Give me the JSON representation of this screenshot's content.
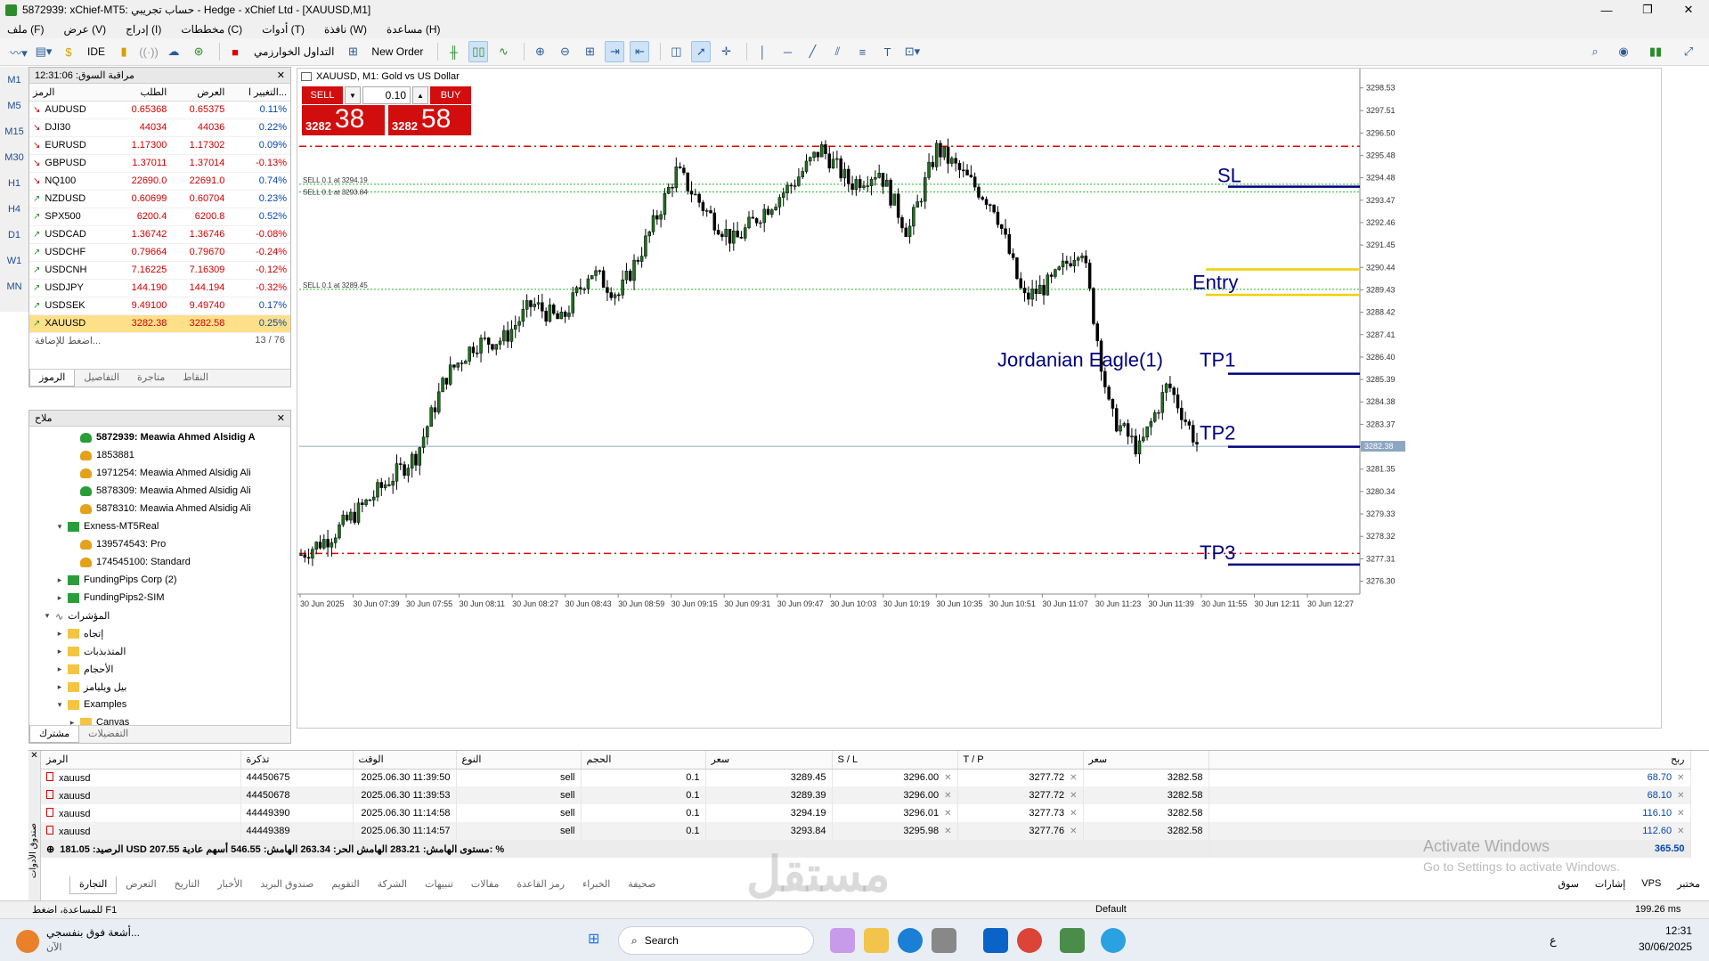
{
  "window": {
    "title": "5872939: xChief-MT5: حساب تجريبي - Hedge - xChief Ltd - [XAUUSD,M1]",
    "minimize": "—",
    "maximize": "❐",
    "close": "✕"
  },
  "menu": [
    "ملف (F)",
    "عرض (V)",
    "إدراج (I)",
    "مخططات (C)",
    "أدوات (T)",
    "نافذة (W)",
    "مساعدة (H)"
  ],
  "toolbar": {
    "ide": "IDE",
    "algo": "التداول الخوارزمي",
    "new_order": "New Order"
  },
  "timeframes": [
    "M1",
    "M5",
    "M15",
    "M30",
    "H1",
    "H4",
    "D1",
    "W1",
    "MN"
  ],
  "selected_timeframe": "M1",
  "market_watch": {
    "title": "مراقبة السوق: 12:31:06",
    "columns": [
      "الرمز",
      "الطلب",
      "العرض",
      "التغيير ا..."
    ],
    "rows": [
      {
        "symbol": "AUDUSD",
        "bid": "0.65368",
        "ask": "0.65375",
        "change": "0.11%",
        "dir": "down"
      },
      {
        "symbol": "DJI30",
        "bid": "44034",
        "ask": "44036",
        "change": "0.22%",
        "dir": "down"
      },
      {
        "symbol": "EURUSD",
        "bid": "1.17300",
        "ask": "1.17302",
        "change": "0.09%",
        "dir": "down"
      },
      {
        "symbol": "GBPUSD",
        "bid": "1.37011",
        "ask": "1.37014",
        "change": "-0.13%",
        "dir": "down"
      },
      {
        "symbol": "NQ100",
        "bid": "22690.0",
        "ask": "22691.0",
        "change": "0.74%",
        "dir": "down"
      },
      {
        "symbol": "NZDUSD",
        "bid": "0.60699",
        "ask": "0.60704",
        "change": "0.23%",
        "dir": "up"
      },
      {
        "symbol": "SPX500",
        "bid": "6200.4",
        "ask": "6200.8",
        "change": "0.52%",
        "dir": "up"
      },
      {
        "symbol": "USDCAD",
        "bid": "1.36742",
        "ask": "1.36746",
        "change": "-0.08%",
        "dir": "up"
      },
      {
        "symbol": "USDCHF",
        "bid": "0.79664",
        "ask": "0.79670",
        "change": "-0.24%",
        "dir": "up"
      },
      {
        "symbol": "USDCNH",
        "bid": "7.16225",
        "ask": "7.16309",
        "change": "-0.12%",
        "dir": "up"
      },
      {
        "symbol": "USDJPY",
        "bid": "144.190",
        "ask": "144.194",
        "change": "-0.32%",
        "dir": "up"
      },
      {
        "symbol": "USDSEK",
        "bid": "9.49100",
        "ask": "9.49740",
        "change": "0.17%",
        "dir": "up"
      },
      {
        "symbol": "XAUUSD",
        "bid": "3282.38",
        "ask": "3282.58",
        "change": "0.25%",
        "dir": "up"
      }
    ],
    "add_hint": "اضغط للإضافة...",
    "count": "13 / 76",
    "tabs": [
      "الرموز",
      "التفاصيل",
      "متاجرة",
      "النقاط"
    ]
  },
  "navigator": {
    "title": "ملاح",
    "items": [
      {
        "label": "5872939: Meawia Ahmed Alsidig A",
        "icon": "usergreen",
        "level": 3,
        "bold": true
      },
      {
        "label": "1853881",
        "icon": "user",
        "level": 3
      },
      {
        "label": "1971254: Meawia Ahmed Alsidig Ali",
        "icon": "user",
        "level": 3
      },
      {
        "label": "5878309: Meawia Ahmed Alsidig Ali",
        "icon": "usergreen",
        "level": 3
      },
      {
        "label": "5878310: Meawia Ahmed Alsidig Ali",
        "icon": "user",
        "level": 3
      },
      {
        "label": "Exness-MT5Real",
        "icon": "server",
        "level": 2,
        "exp": "v"
      },
      {
        "label": "139574543: Pro",
        "icon": "user",
        "level": 3
      },
      {
        "label": "174545100: Standard",
        "icon": "user",
        "level": 3
      },
      {
        "label": "FundingPips Corp (2)",
        "icon": "server",
        "level": 2,
        "exp": ">"
      },
      {
        "label": "FundingPips2-SIM",
        "icon": "server",
        "level": 2,
        "exp": ">"
      },
      {
        "label": "المؤشرات",
        "icon": "ind",
        "level": 1,
        "exp": "v"
      },
      {
        "label": "إتجاه",
        "icon": "folder",
        "level": 2,
        "exp": ">"
      },
      {
        "label": "المتذبذبات",
        "icon": "folder",
        "level": 2,
        "exp": ">"
      },
      {
        "label": "الأحجام",
        "icon": "folder",
        "level": 2,
        "exp": ">"
      },
      {
        "label": "بيل ويليامز",
        "icon": "folder",
        "level": 2,
        "exp": ">"
      },
      {
        "label": "Examples",
        "icon": "folder",
        "level": 2,
        "exp": "v"
      },
      {
        "label": "Canvas",
        "icon": "folder",
        "level": 3,
        "exp": ">"
      }
    ],
    "tabs": [
      "مشترك",
      "التفضيلات"
    ]
  },
  "chart": {
    "title": "XAUUSD, M1:  Gold vs US Dollar",
    "sell_label": "SELL",
    "buy_label": "BUY",
    "volume": "0.10",
    "sell_small": "3282",
    "sell_big": "38",
    "buy_small": "3282",
    "buy_big": "58",
    "y_ticks": [
      "3298.53",
      "3297.51",
      "3296.50",
      "3295.48",
      "3294.48",
      "3293.47",
      "3292.46",
      "3291.45",
      "3290.44",
      "3289.43",
      "3288.42",
      "3287.41",
      "3286.40",
      "3285.39",
      "3284.38",
      "3283.37",
      "3282.36",
      "3281.35",
      "3280.34",
      "3279.33",
      "3278.32",
      "3277.31",
      "3276.30"
    ],
    "x_ticks": [
      "30 Jun 2025",
      "30 Jun 07:39",
      "30 Jun 07:55",
      "30 Jun 08:11",
      "30 Jun 08:27",
      "30 Jun 08:43",
      "30 Jun 08:59",
      "30 Jun 09:15",
      "30 Jun 09:31",
      "30 Jun 09:47",
      "30 Jun 10:03",
      "30 Jun 10:19",
      "30 Jun 10:35",
      "30 Jun 10:51",
      "30 Jun 11:07",
      "30 Jun 11:23",
      "30 Jun 11:39",
      "30 Jun 11:55",
      "30 Jun 12:11",
      "30 Jun 12:27"
    ],
    "current_price": "3282.38",
    "order_labels": [
      "SELL 0.1 at 3294.19",
      "SELL 0.1 at 3293.84",
      "SELL 0.1 at 3289.45"
    ],
    "annotations": {
      "sl": "SL",
      "entry": "Entry",
      "tp1": "TP1",
      "tp2": "TP2",
      "tp3": "TP3",
      "brand": "Jordanian Eagle(1)"
    },
    "colors": {
      "bull": "#1f6f1f",
      "bear": "#000000",
      "stop": "#e00000",
      "level": "#000080",
      "entry": "#f0d000",
      "order": "#22bb22"
    }
  },
  "chart_data": {
    "type": "candlestick",
    "title": "XAUUSD, M1:  Gold vs US Dollar",
    "ylim": [
      3275.8,
      3299.0
    ],
    "x_range": [
      "30 Jun 2025",
      "30 Jun 12:27"
    ],
    "path_close": [
      3277.5,
      3278.3,
      3279.5,
      3280.8,
      3282.0,
      3285.5,
      3287.0,
      3287.2,
      3288.8,
      3288.0,
      3290.3,
      3289.2,
      3291.8,
      3294.8,
      3293.0,
      3291.6,
      3293.0,
      3294.2,
      3295.8,
      3294.2,
      3294.8,
      3292.0,
      3295.8,
      3294.5,
      3293.2,
      3289.0,
      3289.8,
      3291.5,
      3283.8,
      3282.2,
      3285.2,
      3282.5
    ],
    "levels": {
      "sl": 3294.08,
      "entry_high": 3290.35,
      "entry_low": 3289.2,
      "tp1": 3285.65,
      "tp2": 3282.36,
      "tp3": 3277.05,
      "stop_dash_top": 3295.9,
      "stop_dash_bottom": 3277.55,
      "current": 3282.38
    }
  },
  "trades": {
    "columns": [
      "الرمز",
      "تذكرة",
      "الوقت",
      "النوع",
      "الحجم",
      "سعر",
      "S / L",
      "T / P",
      "سعر",
      "ربح"
    ],
    "rows": [
      {
        "symbol": "xauusd",
        "ticket": "44450675",
        "time": "2025.06.30 11:39:50",
        "type": "sell",
        "volume": "0.1",
        "price": "3289.45",
        "sl": "3296.00",
        "tp": "3277.72",
        "cur": "3282.58",
        "profit": "68.70"
      },
      {
        "symbol": "xauusd",
        "ticket": "44450678",
        "time": "2025.06.30 11:39:53",
        "type": "sell",
        "volume": "0.1",
        "price": "3289.39",
        "sl": "3296.00",
        "tp": "3277.72",
        "cur": "3282.58",
        "profit": "68.10"
      },
      {
        "symbol": "xauusd",
        "ticket": "44449390",
        "time": "2025.06.30 11:14:58",
        "type": "sell",
        "volume": "0.1",
        "price": "3294.19",
        "sl": "3296.01",
        "tp": "3277.73",
        "cur": "3282.58",
        "profit": "116.10"
      },
      {
        "symbol": "xauusd",
        "ticket": "44449389",
        "time": "2025.06.30 11:14:57",
        "type": "sell",
        "volume": "0.1",
        "price": "3293.84",
        "sl": "3295.98",
        "tp": "3277.76",
        "cur": "3282.58",
        "profit": "112.60"
      }
    ],
    "balance_line": "الرصيد: 181.05 USD  207.55 مستوى الهامش: 283.21  الهامش الحر: 263.34  الهامش: 546.55  أسهم عادية: %",
    "total": "365.50",
    "tabs": [
      "التجارة",
      "التعرض",
      "التاريخ",
      "الأخبار",
      "صندوق البريد",
      "التقويم",
      "الشركة",
      "تنبيهات",
      "مقالات",
      "رمز القاعدة",
      "الخبراء",
      "صحيفة"
    ],
    "right_items": [
      "سوق",
      "إشارات",
      "VPS",
      "مختبر"
    ],
    "side_label": "صندوق الأدوات"
  },
  "status": {
    "help": "للمساعدة، اضغط F1",
    "profile": "Default",
    "ping": "199.26 ms"
  },
  "watermark": {
    "line1": "Activate Windows",
    "line2": "Go to Settings to activate Windows."
  },
  "taskbar": {
    "search": "Search",
    "news": "أشعة فوق بنفسجي...",
    "news_sub": "الآن",
    "time": "12:31",
    "date": "30/06/2025",
    "lang": "ع"
  }
}
